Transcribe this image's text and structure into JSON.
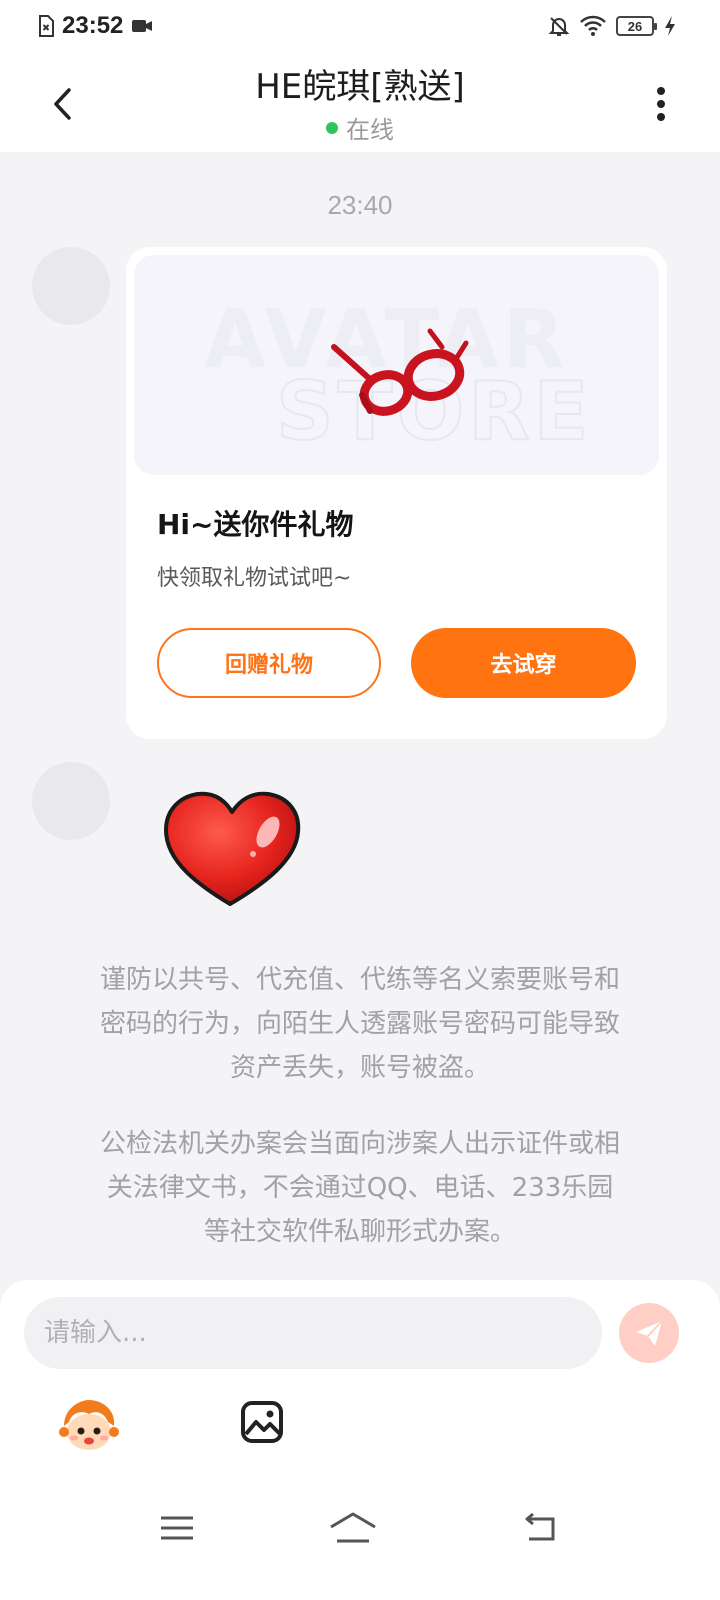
{
  "status_bar": {
    "time": "23:52",
    "battery_level": "26"
  },
  "header": {
    "title": "HE皖琪[熟送]",
    "status": "在线"
  },
  "chat": {
    "time_divider": "23:40",
    "gift_card": {
      "title": "Hi~送你件礼物",
      "subtitle": "快领取礼物试试吧~",
      "return_gift_label": "回赠礼物",
      "try_on_label": "去试穿",
      "image_watermark": [
        "AVATAR",
        "STORE"
      ]
    },
    "notices": [
      [
        "谨防以共号、代充值、代练等名义索要账号和",
        "密码的行为，向陌生人透露账号密码可能导致",
        "资产丢失，账号被盗。"
      ],
      [
        "公检法机关办案会当面向涉案人出示证件或相",
        "关法律文书，不会通过QQ、电话、233乐园",
        "等社交软件私聊形式办案。"
      ]
    ]
  },
  "composer": {
    "placeholder": "请输入..."
  },
  "colors": {
    "accent": "#ff7411",
    "online": "#2ec55a",
    "send_disabled": "#ffcfc5"
  },
  "icons": [
    "sim-card-icon",
    "video-icon",
    "bell-off-icon",
    "wifi-icon",
    "battery-icon",
    "charging-icon",
    "back-arrow-icon",
    "more-vertical-icon",
    "send-icon",
    "emoji-mascot-icon",
    "image-icon",
    "menu-icon",
    "home-icon",
    "back-icon"
  ]
}
